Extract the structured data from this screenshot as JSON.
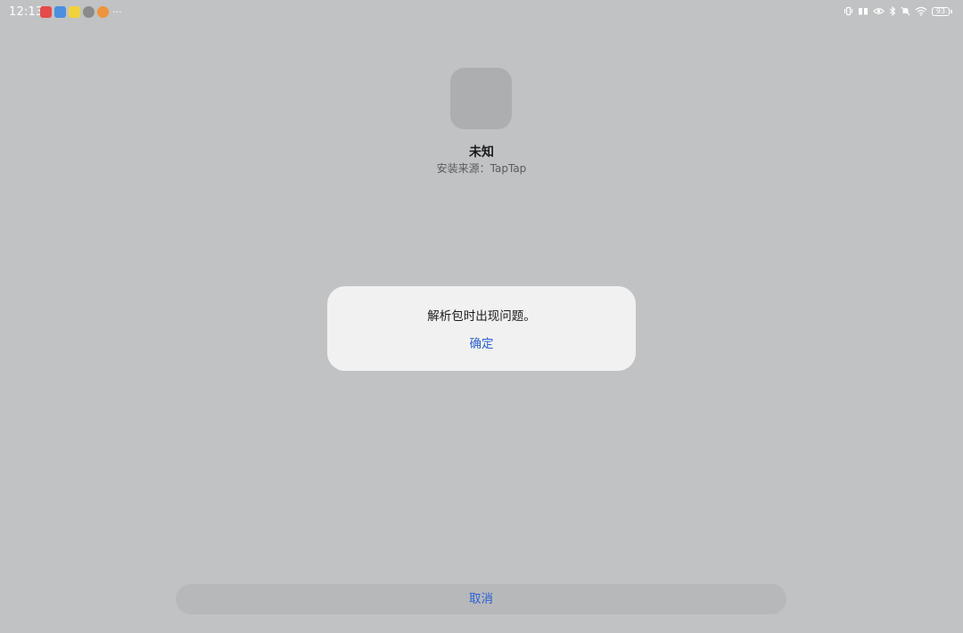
{
  "status_bar": {
    "time": "12:13",
    "more_indicator": "···",
    "battery_level": "93",
    "notification_icons": [
      {
        "name": "red-app-notification-icon",
        "color": "#e84a4a"
      },
      {
        "name": "blue-app-notification-icon",
        "color": "#4a8fe0"
      },
      {
        "name": "yellow-app-notification-icon",
        "color": "#f2d23a"
      },
      {
        "name": "gray-app-notification-icon",
        "color": "#8a8a8a"
      },
      {
        "name": "orange-app-notification-icon",
        "color": "#f0933a"
      }
    ],
    "system_icons": [
      "vibrate-icon",
      "reading-mode-icon",
      "eye-comfort-icon",
      "bluetooth-icon",
      "mute-icon",
      "wifi-icon",
      "battery-icon"
    ]
  },
  "app": {
    "name": "未知",
    "source": "安装来源：TapTap"
  },
  "dialog": {
    "message": "解析包时出现问题。",
    "confirm_label": "确定"
  },
  "footer": {
    "cancel_label": "取消"
  },
  "colors": {
    "background": "#c1c2c3",
    "accent": "#2b5fd9",
    "dialog_bg": "#f1f1f1"
  }
}
